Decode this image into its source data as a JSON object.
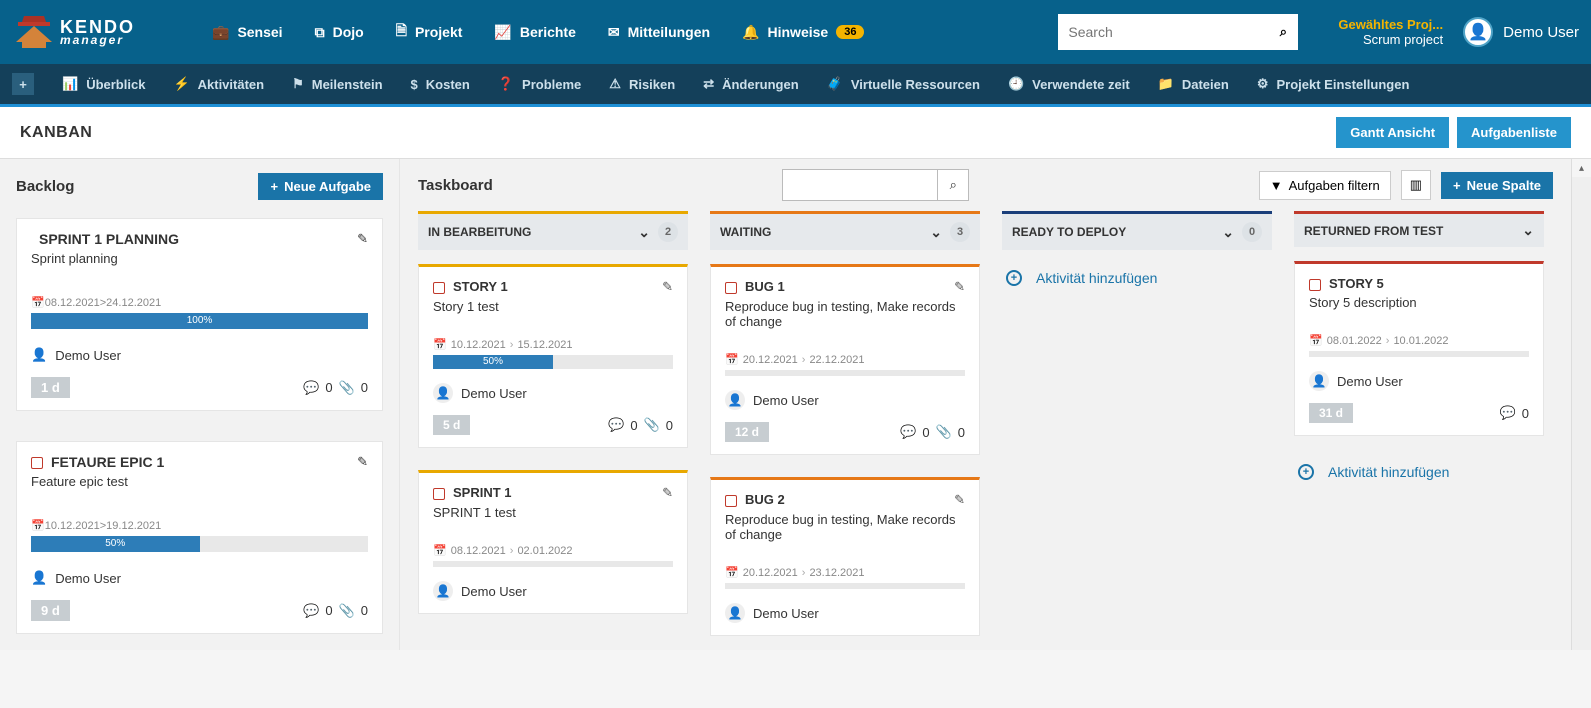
{
  "header": {
    "logo_top": "KENDO",
    "logo_bottom": "manager",
    "nav": [
      {
        "icon": "briefcase",
        "label": "Sensei"
      },
      {
        "icon": "copy",
        "label": "Dojo"
      },
      {
        "icon": "file",
        "label": "Projekt"
      },
      {
        "icon": "chart",
        "label": "Berichte"
      },
      {
        "icon": "mail",
        "label": "Mitteilungen"
      },
      {
        "icon": "bell",
        "label": "Hinweise",
        "badge": "36"
      }
    ],
    "search_placeholder": "Search",
    "project_line1": "Gewähltes Proj...",
    "project_line2": "Scrum project",
    "user": "Demo User"
  },
  "subnav": [
    {
      "icon": "plus",
      "label": ""
    },
    {
      "icon": "chart",
      "label": "Überblick"
    },
    {
      "icon": "bolt",
      "label": "Aktivitäten"
    },
    {
      "icon": "flag",
      "label": "Meilenstein"
    },
    {
      "icon": "dollar",
      "label": "Kosten"
    },
    {
      "icon": "question",
      "label": "Probleme"
    },
    {
      "icon": "warn",
      "label": "Risiken"
    },
    {
      "icon": "swap",
      "label": "Änderungen"
    },
    {
      "icon": "case",
      "label": "Virtuelle Ressourcen"
    },
    {
      "icon": "clock",
      "label": "Verwendete zeit"
    },
    {
      "icon": "folder",
      "label": "Dateien"
    },
    {
      "icon": "gear",
      "label": "Projekt Einstellungen"
    }
  ],
  "kanban": {
    "title": "KANBAN",
    "gantt_btn": "Gantt Ansicht",
    "tasklist_btn": "Aufgabenliste"
  },
  "backlog": {
    "title": "Backlog",
    "new_task_btn": "Neue Aufgabe",
    "cards": [
      {
        "done": true,
        "title": "SPRINT 1 PLANNING",
        "desc": "Sprint planning",
        "dates": "08.12.2021>24.12.2021",
        "progress": 100,
        "progress_txt": "100%",
        "user": "Demo User",
        "days": "1 d",
        "comments": 0,
        "attach": 0
      },
      {
        "done": false,
        "title": "FETAURE EPIC 1",
        "desc": "Feature epic test",
        "dates": "10.12.2021>19.12.2021",
        "progress": 50,
        "progress_txt": "50%",
        "user": "Demo User",
        "days": "9 d",
        "comments": 0,
        "attach": 0
      }
    ]
  },
  "taskboard": {
    "title": "Taskboard",
    "filter_btn": "Aufgaben filtern",
    "new_col_btn": "Neue Spalte",
    "add_activity": "Aktivität hinzufügen",
    "columns": [
      {
        "name": "IN BEARBEITUNG",
        "color": "yellow",
        "count": 2,
        "cards": [
          {
            "title": "STORY 1",
            "desc": "Story 1 test",
            "d1": "10.12.2021",
            "d2": "15.12.2021",
            "progress": 50,
            "progress_txt": "50%",
            "user": "Demo User",
            "days": "5 d",
            "comments": 0,
            "attach": 0
          },
          {
            "title": "SPRINT 1",
            "desc": "SPRINT 1 test",
            "d1": "08.12.2021",
            "d2": "02.01.2022",
            "user": "Demo User"
          }
        ]
      },
      {
        "name": "WAITING",
        "color": "orange",
        "count": 3,
        "cards": [
          {
            "title": "BUG 1",
            "desc": "Reproduce bug in testing, Make records of change",
            "d1": "20.12.2021",
            "d2": "22.12.2021",
            "user": "Demo User",
            "days": "12 d",
            "comments": 0,
            "attach": 0
          },
          {
            "title": "BUG 2",
            "desc": "Reproduce bug in testing, Make records of change",
            "d1": "20.12.2021",
            "d2": "23.12.2021",
            "user": "Demo User"
          }
        ]
      },
      {
        "name": "READY TO DEPLOY",
        "color": "navy",
        "count": 0,
        "cards": [],
        "show_add": true
      },
      {
        "name": "RETURNED FROM TEST",
        "color": "red",
        "count": null,
        "cards": [
          {
            "title": "STORY 5",
            "desc": "Story 5 description",
            "d1": "08.01.2022",
            "d2": "10.01.2022",
            "user": "Demo User",
            "days": "31 d",
            "comments": 0
          }
        ],
        "show_add": true
      }
    ]
  }
}
